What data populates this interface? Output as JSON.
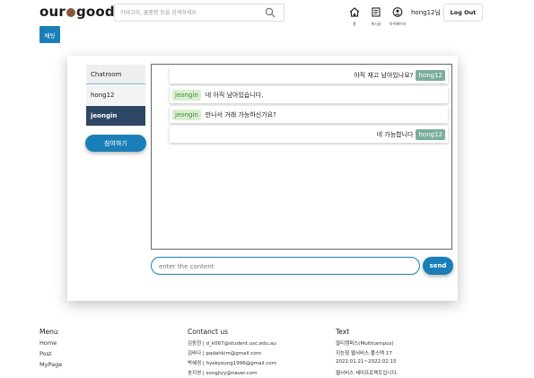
{
  "header": {
    "logo_left": "our",
    "logo_right": "goods",
    "search_placeholder": "카테고리, 물품명 등을 검색하세요",
    "nav": [
      {
        "label": "홈"
      },
      {
        "label": "게시글"
      },
      {
        "label": "마이페이지"
      }
    ],
    "user_greeting": "hong12님",
    "logout_label": "Log Out"
  },
  "chat_tab_label": "채팅",
  "rooms": {
    "title": "Chatroom",
    "items": [
      {
        "label": "hong12"
      },
      {
        "label": "jeongin"
      }
    ],
    "join_label": "참여하기"
  },
  "messages": [
    {
      "side": "right",
      "text": "아직 재고 남아있나요?",
      "user": "hong12"
    },
    {
      "side": "left",
      "text": "네 아직 남아있습니다.",
      "user": "jeongin"
    },
    {
      "side": "left",
      "text": "만나서 거래 가능하신가요?",
      "user": "jeongin"
    },
    {
      "side": "right",
      "text": "네 가능합니다",
      "user": "hong12"
    }
  ],
  "composer": {
    "placeholder": "enter the content",
    "send_label": "send"
  },
  "footer": {
    "menu": {
      "title": "Menu",
      "links": [
        "Home",
        "Post",
        "MyPage"
      ]
    },
    "contact": {
      "title": "Contanct us",
      "lines": [
        "김동현 | d_k067@student.usc.edu.au",
        "김바다 | padahkim@gmail.com",
        "박혜경 | hyekyoung1996@gmail.com",
        "송지영 | songjiyy@naver.com"
      ]
    },
    "text": {
      "title": "Text",
      "lines": [
        "멀티캠퍼스(Multicampus)",
        "지능형 웹서비스 풀스택 17",
        "2022.01.21~2022.02.15",
        "웹서비스 세미프로젝트입니다."
      ]
    }
  },
  "colors": {
    "accent": "#1a7fb8",
    "active_room": "#2e4764",
    "my_badge": "#7aae9a",
    "other_badge": "#d9efcf"
  }
}
